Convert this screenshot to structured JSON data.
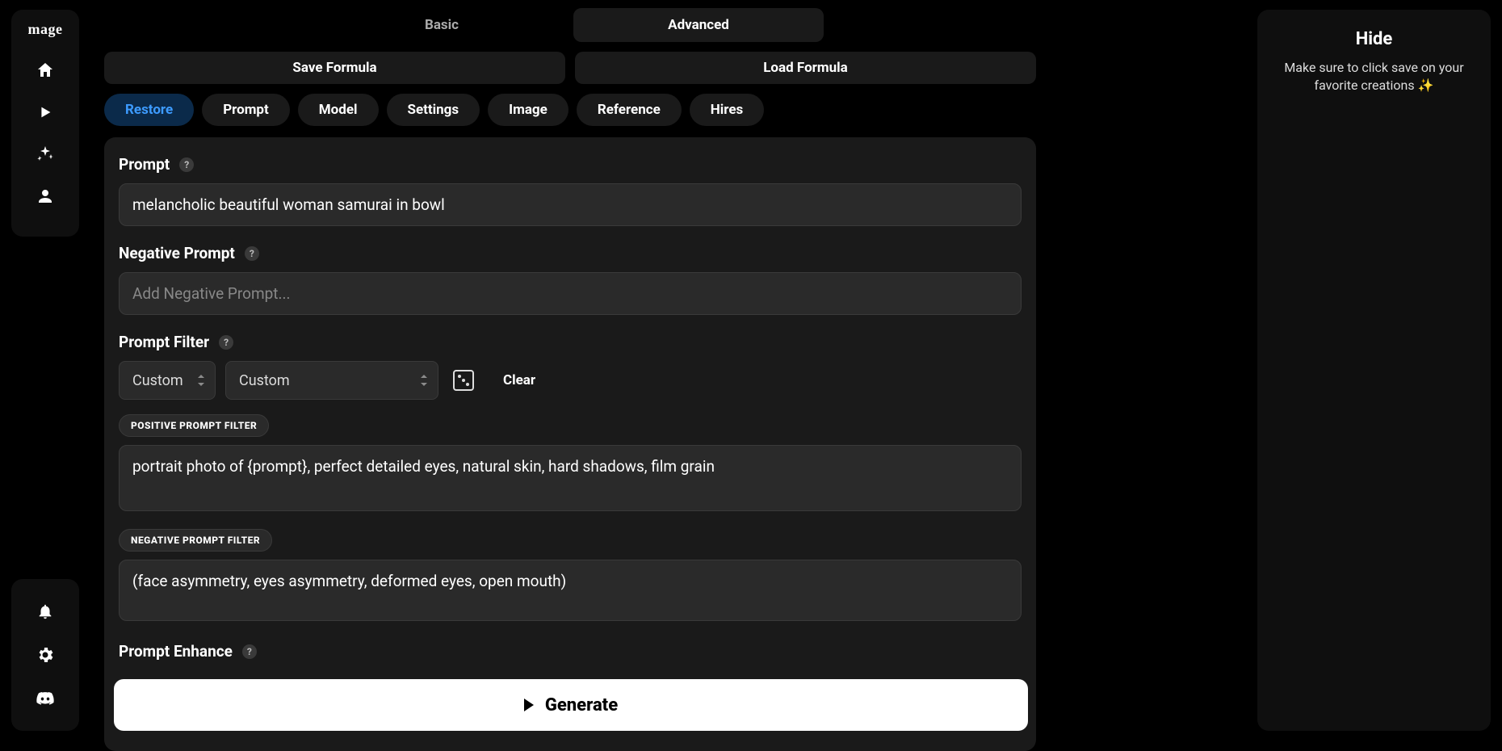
{
  "logo": "mage",
  "modeTabs": {
    "basic": "Basic",
    "advanced": "Advanced"
  },
  "formula": {
    "save": "Save Formula",
    "load": "Load Formula"
  },
  "navChips": {
    "restore": "Restore",
    "prompt": "Prompt",
    "model": "Model",
    "settings": "Settings",
    "image": "Image",
    "reference": "Reference",
    "hires": "Hires"
  },
  "sections": {
    "prompt": {
      "label": "Prompt",
      "value": "melancholic beautiful woman samurai in bowl"
    },
    "negative": {
      "label": "Negative Prompt",
      "placeholder": "Add Negative Prompt..."
    },
    "filter": {
      "label": "Prompt Filter",
      "select1": "Custom",
      "select2": "Custom",
      "clear": "Clear",
      "positivePill": "POSITIVE PROMPT FILTER",
      "positiveValue": "portrait photo of {prompt}, perfect detailed eyes, natural skin, hard shadows, film grain",
      "negativePill": "NEGATIVE PROMPT FILTER",
      "negativeValue": "(face asymmetry, eyes asymmetry, deformed eyes, open mouth)"
    },
    "enhance": {
      "label": "Prompt Enhance"
    }
  },
  "generate": "Generate",
  "rightPanel": {
    "hide": "Hide",
    "msg": "Make sure to click save on your favorite creations ✨"
  }
}
